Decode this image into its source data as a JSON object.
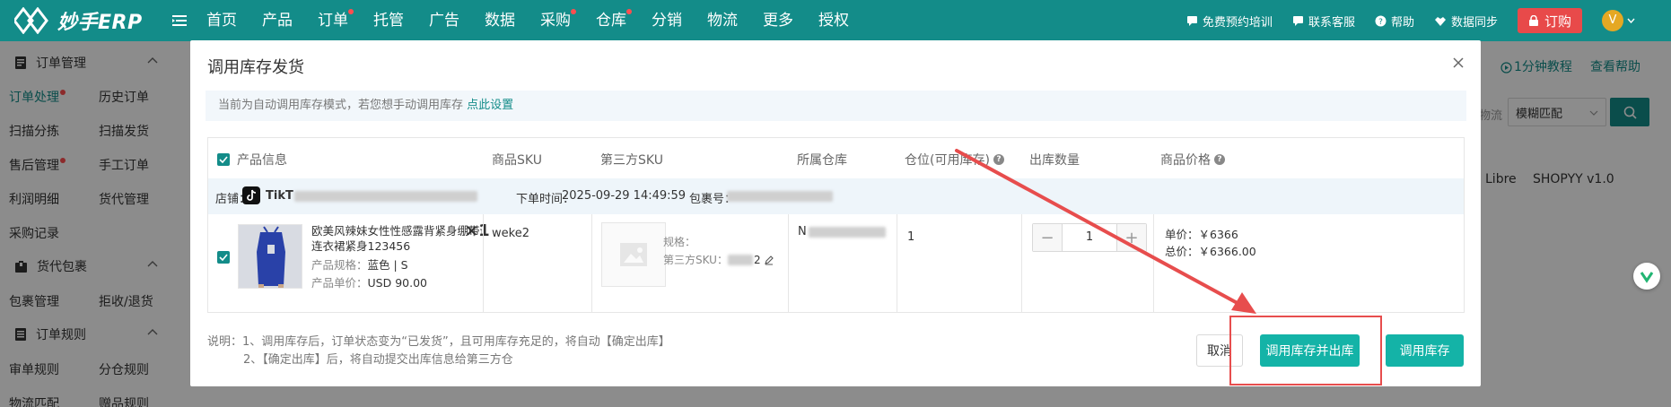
{
  "brand": {
    "name": "妙手ERP"
  },
  "nav": {
    "items": [
      {
        "label": "首页",
        "dot": false
      },
      {
        "label": "产品",
        "dot": false
      },
      {
        "label": "订单",
        "dot": true
      },
      {
        "label": "托管",
        "dot": false
      },
      {
        "label": "广告",
        "dot": false
      },
      {
        "label": "数据",
        "dot": false
      },
      {
        "label": "采购",
        "dot": true
      },
      {
        "label": "仓库",
        "dot": true
      },
      {
        "label": "分销",
        "dot": false
      },
      {
        "label": "物流",
        "dot": false
      },
      {
        "label": "更多",
        "dot": false
      },
      {
        "label": "授权",
        "dot": false
      }
    ]
  },
  "tools": {
    "training": "免费预约培训",
    "support": "联系客服",
    "help": "帮助",
    "sync": "数据同步",
    "order": "订购",
    "avatar": "V"
  },
  "sidebar": {
    "order_mgmt": "订单管理",
    "order_process": "订单处理",
    "history_orders": "历史订单",
    "scan_pick": "扫描分拣",
    "scan_ship": "扫描发货",
    "aftersale": "售后管理",
    "manual_order": "手工订单",
    "profit": "利润明细",
    "goods_mgmt": "货代管理",
    "purchase_records": "采购记录",
    "package": "货代包裹",
    "package_mgmt": "包裹管理",
    "reject_return": "拒收/退货",
    "order_rules": "订单规则",
    "review_rules": "审单规则",
    "warehouse_rules": "分仓规则",
    "logistics_match": "物流匹配",
    "gift_rules": "赠品规则"
  },
  "background": {
    "tutorial": "1分钟教程",
    "help": "查看帮助",
    "logistics_partial": "物流",
    "fuzzy": "模糊匹配",
    "store_libre": "Libre",
    "store_shopyy": "SHOPYY v1.0"
  },
  "modal": {
    "title": "调用库存发货",
    "notice": "当前为自动调用库存模式，若您想手动调用库存",
    "notice_link": "点此设置",
    "headers": {
      "product": "产品信息",
      "sku": "商品SKU",
      "third_sku": "第三方SKU",
      "warehouse": "所属仓库",
      "location": "仓位(可用库存)",
      "qty": "出库数量",
      "price": "商品价格"
    },
    "shop_row": {
      "store_label": "店铺：",
      "store_name": "TikT",
      "order_time_label": "下单时间：",
      "order_time": "2025-09-29 14:49:59",
      "package_label": "包裹号："
    },
    "product": {
      "title_line1": "欧美风辣妹女性性感露背紧身绷带连体",
      "title_line2": "连衣裙紧身123456",
      "qty_mark": "×1",
      "spec_label": "产品规格：",
      "spec_value": "蓝色 | S",
      "unit_price_label": "产品单价：",
      "unit_price": "USD 90.00",
      "sku": "weke2",
      "third_spec_label": "规格：",
      "third_sku_label": "第三方SKU：",
      "third_sku_suffix": "2",
      "warehouse_prefix": "N",
      "location": "1",
      "qty": "1",
      "price_label": "单价：",
      "price": "￥6366",
      "total_label": "总价：",
      "total": "￥6366.00"
    },
    "note_line1": "说明：1、调用库存后，订单状态变为“已发货”，且可用库存充足的，将自动【确定出库】",
    "note_line2": "2、【确定出库】后，将自动提交出库信息给第三方仓",
    "buttons": {
      "cancel": "取消",
      "call_and_out": "调用库存并出库",
      "call": "调用库存"
    }
  },
  "colors": {
    "brand": "#138c89",
    "primary_button": "#14b3a7",
    "annotation": "#e74d4d",
    "notice_bg": "#f2f7fb",
    "shop_row_bg": "#eef5fa"
  }
}
